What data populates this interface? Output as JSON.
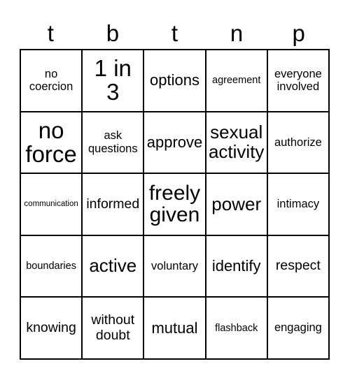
{
  "card": {
    "type": "bingo-card",
    "rows": 5,
    "columns": 5,
    "background_color": "#ffffff",
    "border_color": "#000000",
    "text_color": "#000000"
  },
  "header": {
    "letters": [
      {
        "label": "t"
      },
      {
        "label": "b"
      },
      {
        "label": "t"
      },
      {
        "label": "n"
      },
      {
        "label": "p"
      }
    ]
  },
  "grid": {
    "cells": [
      {
        "text": "no coercion",
        "size": "fs-md",
        "row": 1,
        "col": 1
      },
      {
        "text": "1 in 3",
        "size": "fs-4xl",
        "row": 1,
        "col": 2
      },
      {
        "text": "options",
        "size": "fs-xl",
        "row": 1,
        "col": 3
      },
      {
        "text": "agreement",
        "size": "fs-sm",
        "row": 1,
        "col": 4
      },
      {
        "text": "everyone involved",
        "size": "fs-md",
        "row": 1,
        "col": 5
      },
      {
        "text": "no force",
        "size": "fs-4xl",
        "row": 2,
        "col": 1
      },
      {
        "text": "ask questions",
        "size": "fs-md",
        "row": 2,
        "col": 2
      },
      {
        "text": "approve",
        "size": "fs-xl",
        "row": 2,
        "col": 3
      },
      {
        "text": "sexual activity",
        "size": "fs-2xl",
        "row": 2,
        "col": 4
      },
      {
        "text": "authorize",
        "size": "fs-md",
        "row": 2,
        "col": 5
      },
      {
        "text": "communication",
        "size": "fs-xs",
        "row": 3,
        "col": 1
      },
      {
        "text": "informed",
        "size": "fs-lg",
        "row": 3,
        "col": 2
      },
      {
        "text": "freely given",
        "size": "fs-3xl",
        "row": 3,
        "col": 3
      },
      {
        "text": "power",
        "size": "fs-2xl",
        "row": 3,
        "col": 4
      },
      {
        "text": "intimacy",
        "size": "fs-md",
        "row": 3,
        "col": 5
      },
      {
        "text": "boundaries",
        "size": "fs-sm",
        "row": 4,
        "col": 1
      },
      {
        "text": "active",
        "size": "fs-2xl",
        "row": 4,
        "col": 2
      },
      {
        "text": "voluntary",
        "size": "fs-md",
        "row": 4,
        "col": 3
      },
      {
        "text": "identify",
        "size": "fs-xl",
        "row": 4,
        "col": 4
      },
      {
        "text": "respect",
        "size": "fs-lg",
        "row": 4,
        "col": 5
      },
      {
        "text": "knowing",
        "size": "fs-lg",
        "row": 5,
        "col": 1
      },
      {
        "text": "without doubt",
        "size": "fs-lg",
        "row": 5,
        "col": 2
      },
      {
        "text": "mutual",
        "size": "fs-xl",
        "row": 5,
        "col": 3
      },
      {
        "text": "flashback",
        "size": "fs-sm",
        "row": 5,
        "col": 4
      },
      {
        "text": "engaging",
        "size": "fs-md",
        "row": 5,
        "col": 5
      }
    ]
  }
}
